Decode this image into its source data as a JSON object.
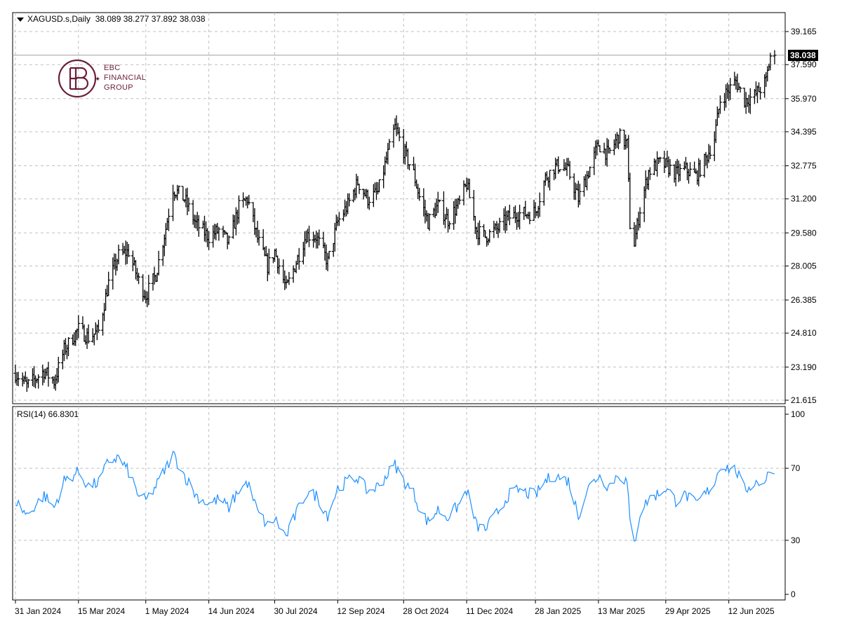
{
  "header": {
    "symbol": "XAGUSD.s,Daily",
    "ohlc": "38.089 38.277 37.892 38.038"
  },
  "rsi_header": {
    "label": "RSI(14) 66.8301"
  },
  "logo": {
    "line1": "EBC",
    "line2": "FINANCIAL",
    "line3": "GROUP",
    "color": "#6b1f3a"
  },
  "last_price_label": "38.038",
  "colors": {
    "bars": "#000000",
    "rsi": "#1e90ff",
    "grid": "#c0c0c0",
    "frame": "#000000",
    "last_price_line": "#a0a0a0"
  },
  "chart_data": [
    {
      "type": "ohlc",
      "series_name": "XAGUSD.s,Daily",
      "y_ticks": [
        "39.165",
        "37.590",
        "35.970",
        "34.395",
        "32.775",
        "31.200",
        "29.580",
        "28.005",
        "26.385",
        "24.810",
        "23.190",
        "21.615"
      ],
      "ylim": [
        21.615,
        39.165
      ],
      "x_ticks": [
        "31 Jan 2024",
        "15 Mar 2024",
        "1 May 2024",
        "14 Jun 2024",
        "30 Jul 2024",
        "12 Sep 2024",
        "28 Oct 2024",
        "11 Dec 2024",
        "28 Jan 2025",
        "13 Mar 2025",
        "29 Apr 2025",
        "12 Jun 2025"
      ],
      "last_price": 38.038,
      "grid": true,
      "anchors": [
        {
          "x": "31 Jan 2024",
          "close": 22.9
        },
        {
          "x": "8 Feb 2024",
          "close": 22.3
        },
        {
          "x": "20 Feb 2024",
          "close": 23.0
        },
        {
          "x": "27 Feb 2024",
          "close": 22.5
        },
        {
          "x": "5 Mar 2024",
          "close": 24.0
        },
        {
          "x": "15 Mar 2024",
          "close": 25.0
        },
        {
          "x": "22 Mar 2024",
          "close": 24.6
        },
        {
          "x": "29 Mar 2024",
          "close": 24.9
        },
        {
          "x": "5 Apr 2024",
          "close": 27.2
        },
        {
          "x": "12 Apr 2024",
          "close": 28.5
        },
        {
          "x": "19 Apr 2024",
          "close": 28.7
        },
        {
          "x": "26 Apr 2024",
          "close": 27.3
        },
        {
          "x": "1 May 2024",
          "close": 26.6
        },
        {
          "x": "8 May 2024",
          "close": 27.6
        },
        {
          "x": "15 May 2024",
          "close": 29.8
        },
        {
          "x": "20 May 2024",
          "close": 31.7
        },
        {
          "x": "28 May 2024",
          "close": 31.2
        },
        {
          "x": "5 Jun 2024",
          "close": 30.0
        },
        {
          "x": "14 Jun 2024",
          "close": 29.4
        },
        {
          "x": "21 Jun 2024",
          "close": 29.7
        },
        {
          "x": "28 Jun 2024",
          "close": 29.1
        },
        {
          "x": "5 Jul 2024",
          "close": 30.8
        },
        {
          "x": "11 Jul 2024",
          "close": 31.2
        },
        {
          "x": "18 Jul 2024",
          "close": 29.3
        },
        {
          "x": "25 Jul 2024",
          "close": 28.0
        },
        {
          "x": "30 Jul 2024",
          "close": 28.7
        },
        {
          "x": "7 Aug 2024",
          "close": 26.9
        },
        {
          "x": "14 Aug 2024",
          "close": 28.2
        },
        {
          "x": "21 Aug 2024",
          "close": 29.5
        },
        {
          "x": "28 Aug 2024",
          "close": 29.4
        },
        {
          "x": "5 Sep 2024",
          "close": 28.2
        },
        {
          "x": "12 Sep 2024",
          "close": 30.1
        },
        {
          "x": "19 Sep 2024",
          "close": 30.9
        },
        {
          "x": "26 Sep 2024",
          "close": 32.0
        },
        {
          "x": "3 Oct 2024",
          "close": 31.2
        },
        {
          "x": "10 Oct 2024",
          "close": 31.5
        },
        {
          "x": "18 Oct 2024",
          "close": 33.6
        },
        {
          "x": "22 Oct 2024",
          "close": 34.6
        },
        {
          "x": "28 Oct 2024",
          "close": 33.5
        },
        {
          "x": "4 Nov 2024",
          "close": 32.4
        },
        {
          "x": "8 Nov 2024",
          "close": 31.3
        },
        {
          "x": "14 Nov 2024",
          "close": 30.1
        },
        {
          "x": "21 Nov 2024",
          "close": 30.9
        },
        {
          "x": "28 Nov 2024",
          "close": 30.2
        },
        {
          "x": "6 Dec 2024",
          "close": 31.0
        },
        {
          "x": "11 Dec 2024",
          "close": 31.9
        },
        {
          "x": "18 Dec 2024",
          "close": 29.7
        },
        {
          "x": "24 Dec 2024",
          "close": 29.4
        },
        {
          "x": "2 Jan 2025",
          "close": 29.8
        },
        {
          "x": "9 Jan 2025",
          "close": 30.3
        },
        {
          "x": "16 Jan 2025",
          "close": 30.5
        },
        {
          "x": "23 Jan 2025",
          "close": 30.5
        },
        {
          "x": "28 Jan 2025",
          "close": 30.6
        },
        {
          "x": "4 Feb 2025",
          "close": 32.2
        },
        {
          "x": "10 Feb 2025",
          "close": 32.7
        },
        {
          "x": "14 Feb 2025",
          "close": 32.8
        },
        {
          "x": "20 Feb 2025",
          "close": 32.5
        },
        {
          "x": "27 Feb 2025",
          "close": 31.2
        },
        {
          "x": "5 Mar 2025",
          "close": 32.3
        },
        {
          "x": "13 Mar 2025",
          "close": 33.8
        },
        {
          "x": "20 Mar 2025",
          "close": 33.3
        },
        {
          "x": "27 Mar 2025",
          "close": 34.2
        },
        {
          "x": "2 Apr 2025",
          "close": 33.8
        },
        {
          "x": "4 Apr 2025",
          "close": 30.0
        },
        {
          "x": "7 Apr 2025",
          "close": 29.1
        },
        {
          "x": "11 Apr 2025",
          "close": 30.7
        },
        {
          "x": "17 Apr 2025",
          "close": 32.5
        },
        {
          "x": "24 Apr 2025",
          "close": 32.9
        },
        {
          "x": "29 Apr 2025",
          "close": 32.8
        },
        {
          "x": "6 May 2025",
          "close": 32.4
        },
        {
          "x": "13 May 2025",
          "close": 32.6
        },
        {
          "x": "20 May 2025",
          "close": 32.3
        },
        {
          "x": "27 May 2025",
          "close": 33.1
        },
        {
          "x": "2 Jun 2025",
          "close": 34.1
        },
        {
          "x": "6 Jun 2025",
          "close": 35.9
        },
        {
          "x": "12 Jun 2025",
          "close": 36.4
        },
        {
          "x": "17 Jun 2025",
          "close": 36.8
        },
        {
          "x": "23 Jun 2025",
          "close": 35.9
        },
        {
          "x": "30 Jun 2025",
          "close": 36.1
        },
        {
          "x": "8 Jul 2025",
          "close": 36.8
        },
        {
          "x": "11 Jul 2025",
          "close": 38.0
        },
        {
          "x": "14 Jul 2025",
          "close": 38.038
        }
      ]
    },
    {
      "type": "line",
      "series_name": "RSI(14)",
      "last_value": 66.8301,
      "y_ticks": [
        "100",
        "70",
        "30",
        "0"
      ],
      "ylim": [
        0,
        100
      ],
      "levels": [
        70,
        30
      ],
      "anchors": [
        {
          "x": "31 Jan 2024",
          "rsi": 52
        },
        {
          "x": "8 Feb 2024",
          "rsi": 44
        },
        {
          "x": "20 Feb 2024",
          "rsi": 55
        },
        {
          "x": "27 Feb 2024",
          "rsi": 48
        },
        {
          "x": "5 Mar 2024",
          "rsi": 63
        },
        {
          "x": "15 Mar 2024",
          "rsi": 68
        },
        {
          "x": "22 Mar 2024",
          "rsi": 60
        },
        {
          "x": "29 Mar 2024",
          "rsi": 62
        },
        {
          "x": "5 Apr 2024",
          "rsi": 74
        },
        {
          "x": "12 Apr 2024",
          "rsi": 76
        },
        {
          "x": "19 Apr 2024",
          "rsi": 68
        },
        {
          "x": "26 Apr 2024",
          "rsi": 55
        },
        {
          "x": "1 May 2024",
          "rsi": 52
        },
        {
          "x": "8 May 2024",
          "rsi": 60
        },
        {
          "x": "15 May 2024",
          "rsi": 70
        },
        {
          "x": "20 May 2024",
          "rsi": 78
        },
        {
          "x": "28 May 2024",
          "rsi": 66
        },
        {
          "x": "5 Jun 2024",
          "rsi": 55
        },
        {
          "x": "14 Jun 2024",
          "rsi": 50
        },
        {
          "x": "21 Jun 2024",
          "rsi": 53
        },
        {
          "x": "28 Jun 2024",
          "rsi": 48
        },
        {
          "x": "5 Jul 2024",
          "rsi": 58
        },
        {
          "x": "11 Jul 2024",
          "rsi": 62
        },
        {
          "x": "18 Jul 2024",
          "rsi": 46
        },
        {
          "x": "25 Jul 2024",
          "rsi": 38
        },
        {
          "x": "30 Jul 2024",
          "rsi": 42
        },
        {
          "x": "7 Aug 2024",
          "rsi": 32
        },
        {
          "x": "14 Aug 2024",
          "rsi": 45
        },
        {
          "x": "21 Aug 2024",
          "rsi": 56
        },
        {
          "x": "28 Aug 2024",
          "rsi": 55
        },
        {
          "x": "5 Sep 2024",
          "rsi": 44
        },
        {
          "x": "12 Sep 2024",
          "rsi": 59
        },
        {
          "x": "19 Sep 2024",
          "rsi": 63
        },
        {
          "x": "26 Sep 2024",
          "rsi": 65
        },
        {
          "x": "3 Oct 2024",
          "rsi": 57
        },
        {
          "x": "10 Oct 2024",
          "rsi": 60
        },
        {
          "x": "18 Oct 2024",
          "rsi": 68
        },
        {
          "x": "22 Oct 2024",
          "rsi": 72
        },
        {
          "x": "28 Oct 2024",
          "rsi": 63
        },
        {
          "x": "4 Nov 2024",
          "rsi": 56
        },
        {
          "x": "8 Nov 2024",
          "rsi": 48
        },
        {
          "x": "14 Nov 2024",
          "rsi": 40
        },
        {
          "x": "21 Nov 2024",
          "rsi": 47
        },
        {
          "x": "28 Nov 2024",
          "rsi": 43
        },
        {
          "x": "6 Dec 2024",
          "rsi": 50
        },
        {
          "x": "11 Dec 2024",
          "rsi": 58
        },
        {
          "x": "18 Dec 2024",
          "rsi": 38
        },
        {
          "x": "24 Dec 2024",
          "rsi": 36
        },
        {
          "x": "2 Jan 2025",
          "rsi": 46
        },
        {
          "x": "9 Jan 2025",
          "rsi": 55
        },
        {
          "x": "16 Jan 2025",
          "rsi": 58
        },
        {
          "x": "23 Jan 2025",
          "rsi": 56
        },
        {
          "x": "28 Jan 2025",
          "rsi": 55
        },
        {
          "x": "4 Feb 2025",
          "rsi": 63
        },
        {
          "x": "10 Feb 2025",
          "rsi": 66
        },
        {
          "x": "14 Feb 2025",
          "rsi": 65
        },
        {
          "x": "20 Feb 2025",
          "rsi": 63
        },
        {
          "x": "27 Feb 2025",
          "rsi": 44
        },
        {
          "x": "5 Mar 2025",
          "rsi": 58
        },
        {
          "x": "13 Mar 2025",
          "rsi": 66
        },
        {
          "x": "20 Mar 2025",
          "rsi": 60
        },
        {
          "x": "27 Mar 2025",
          "rsi": 67
        },
        {
          "x": "2 Apr 2025",
          "rsi": 62
        },
        {
          "x": "4 Apr 2025",
          "rsi": 40
        },
        {
          "x": "7 Apr 2025",
          "rsi": 28
        },
        {
          "x": "11 Apr 2025",
          "rsi": 45
        },
        {
          "x": "17 Apr 2025",
          "rsi": 53
        },
        {
          "x": "24 Apr 2025",
          "rsi": 56
        },
        {
          "x": "29 Apr 2025",
          "rsi": 59
        },
        {
          "x": "6 May 2025",
          "rsi": 52
        },
        {
          "x": "13 May 2025",
          "rsi": 55
        },
        {
          "x": "20 May 2025",
          "rsi": 50
        },
        {
          "x": "27 May 2025",
          "rsi": 56
        },
        {
          "x": "2 Jun 2025",
          "rsi": 62
        },
        {
          "x": "6 Jun 2025",
          "rsi": 72
        },
        {
          "x": "12 Jun 2025",
          "rsi": 70
        },
        {
          "x": "17 Jun 2025",
          "rsi": 69
        },
        {
          "x": "23 Jun 2025",
          "rsi": 58
        },
        {
          "x": "30 Jun 2025",
          "rsi": 62
        },
        {
          "x": "8 Jul 2025",
          "rsi": 63
        },
        {
          "x": "11 Jul 2025",
          "rsi": 71
        },
        {
          "x": "14 Jul 2025",
          "rsi": 66.8301
        }
      ]
    }
  ]
}
